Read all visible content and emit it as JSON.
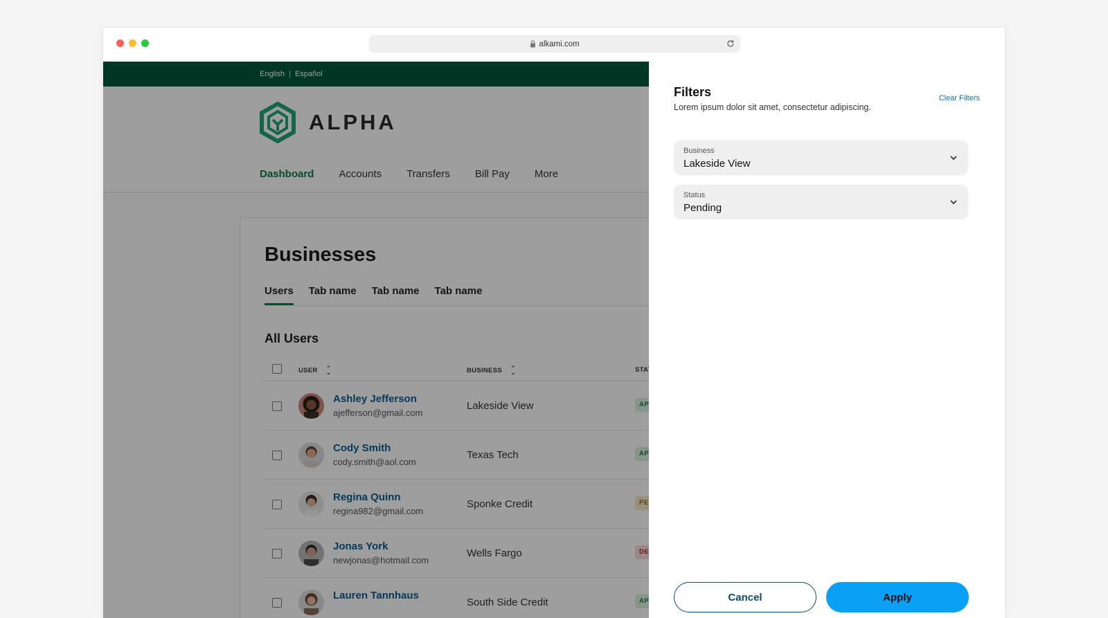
{
  "browser": {
    "url": "alkami.com"
  },
  "site": {
    "languages": [
      "English",
      "Español"
    ],
    "logo_text": "ALPHA",
    "nav": [
      "Dashboard",
      "Accounts",
      "Transfers",
      "Bill Pay",
      "More"
    ],
    "page_title": "Businesses",
    "tabs": [
      "Users",
      "Tab name",
      "Tab name",
      "Tab name"
    ],
    "section_title": "All Users",
    "table": {
      "headers": {
        "user": "USER",
        "business": "BUSINESS",
        "status": "STATU"
      },
      "rows": [
        {
          "name": "Ashley Jefferson",
          "email": "ajefferson@gmail.com",
          "business": "Lakeside View",
          "status": "APPR"
        },
        {
          "name": "Cody Smith",
          "email": "cody.smith@aol.com",
          "business": "Texas Tech",
          "status": "APPR"
        },
        {
          "name": "Regina Quinn",
          "email": "regina982@gmail.com",
          "business": "Sponke Credit",
          "status": "PEND"
        },
        {
          "name": "Jonas York",
          "email": "newjonas@hotmail.com",
          "business": "Wells Fargo",
          "status": "DENI"
        },
        {
          "name": "Lauren Tannhaus",
          "email": "",
          "business": "South Side Credit",
          "status": "APPR"
        }
      ]
    }
  },
  "filters": {
    "title": "Filters",
    "description": "Lorem ipsum dolor sit amet, consectetur adipiscing.",
    "clear_label": "Clear Filters",
    "business_label": "Business",
    "business_value": "Lakeside View",
    "status_label": "Status",
    "status_value": "Pending",
    "cancel_label": "Cancel",
    "apply_label": "Apply"
  },
  "colors": {
    "brand_green": "#00573a",
    "link_blue": "#0a5c8f",
    "apply_blue": "#0aa0f5",
    "approved_bg": "#d7f0dd",
    "pending_bg": "#f6ebc3",
    "denied_bg": "#fadada"
  }
}
